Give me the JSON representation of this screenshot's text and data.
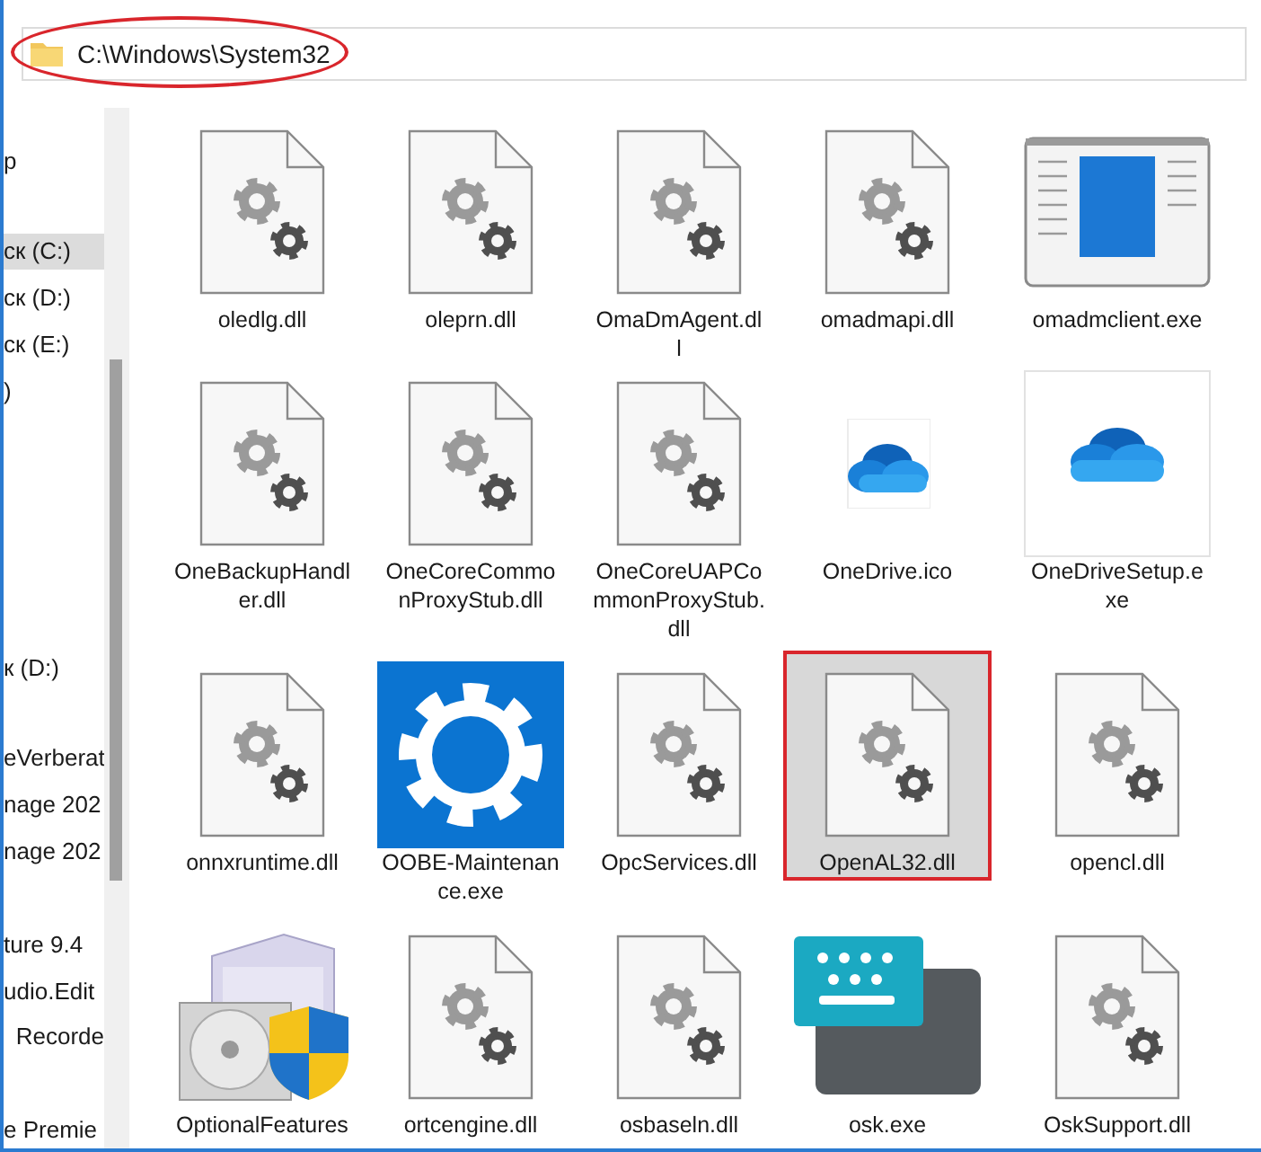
{
  "address_bar": {
    "path": "C:\\Windows\\System32",
    "annotated": true
  },
  "sidebar": {
    "items": [
      {
        "label": "p",
        "selected": false
      },
      {
        "label": "ск (C:)",
        "selected": true
      },
      {
        "label": "ск (D:)",
        "selected": false
      },
      {
        "label": "ск (E:)",
        "selected": false
      },
      {
        "label": ")",
        "selected": false
      },
      {
        "label": "к (D:)",
        "selected": false
      },
      {
        "label": "eVerberat",
        "selected": false
      },
      {
        "label": "nage 202",
        "selected": false
      },
      {
        "label": "nage 202",
        "selected": false
      },
      {
        "label": "ture 9.4",
        "selected": false
      },
      {
        "label": "udio.Edit",
        "selected": false
      },
      {
        "label": "Recorde",
        "selected": false
      },
      {
        "label": "e Premie",
        "selected": false
      }
    ]
  },
  "files": [
    {
      "name": "oledlg.dll",
      "kind": "dll",
      "selected": false,
      "annotated": false
    },
    {
      "name": "oleprn.dll",
      "kind": "dll",
      "selected": false,
      "annotated": false
    },
    {
      "name": "OmaDmAgent.dl\nl",
      "kind": "dll",
      "selected": false,
      "annotated": false
    },
    {
      "name": "omadmapi.dll",
      "kind": "dll",
      "selected": false,
      "annotated": false
    },
    {
      "name": "omadmclient.exe",
      "kind": "window",
      "selected": false,
      "annotated": false
    },
    {
      "name": "OneBackupHandl\ner.dll",
      "kind": "dll",
      "selected": false,
      "annotated": false
    },
    {
      "name": "OneCoreCommo\nnProxyStub.dll",
      "kind": "dll",
      "selected": false,
      "annotated": false
    },
    {
      "name": "OneCoreUAPCo\nmmonProxyStub.\ndll",
      "kind": "dll",
      "selected": false,
      "annotated": false
    },
    {
      "name": "OneDrive.ico",
      "kind": "cloud",
      "selected": false,
      "annotated": false
    },
    {
      "name": "OneDriveSetup.e\nxe",
      "kind": "cloud-tile",
      "selected": false,
      "annotated": false
    },
    {
      "name": "onnxruntime.dll",
      "kind": "dll",
      "selected": false,
      "annotated": false
    },
    {
      "name": "OOBE-Maintenan\nce.exe",
      "kind": "gear-tile",
      "selected": false,
      "annotated": false
    },
    {
      "name": "OpcServices.dll",
      "kind": "dll",
      "selected": false,
      "annotated": false
    },
    {
      "name": "OpenAL32.dll",
      "kind": "dll",
      "selected": true,
      "annotated": true
    },
    {
      "name": "opencl.dll",
      "kind": "dll",
      "selected": false,
      "annotated": false
    },
    {
      "name": "OptionalFeatures",
      "kind": "installer",
      "selected": false,
      "annotated": false
    },
    {
      "name": "ortcengine.dll",
      "kind": "dll",
      "selected": false,
      "annotated": false
    },
    {
      "name": "osbaseln.dll",
      "kind": "dll",
      "selected": false,
      "annotated": false
    },
    {
      "name": "osk.exe",
      "kind": "keyboard",
      "selected": false,
      "annotated": false
    },
    {
      "name": "OskSupport.dll",
      "kind": "dll",
      "selected": false,
      "annotated": false
    }
  ]
}
